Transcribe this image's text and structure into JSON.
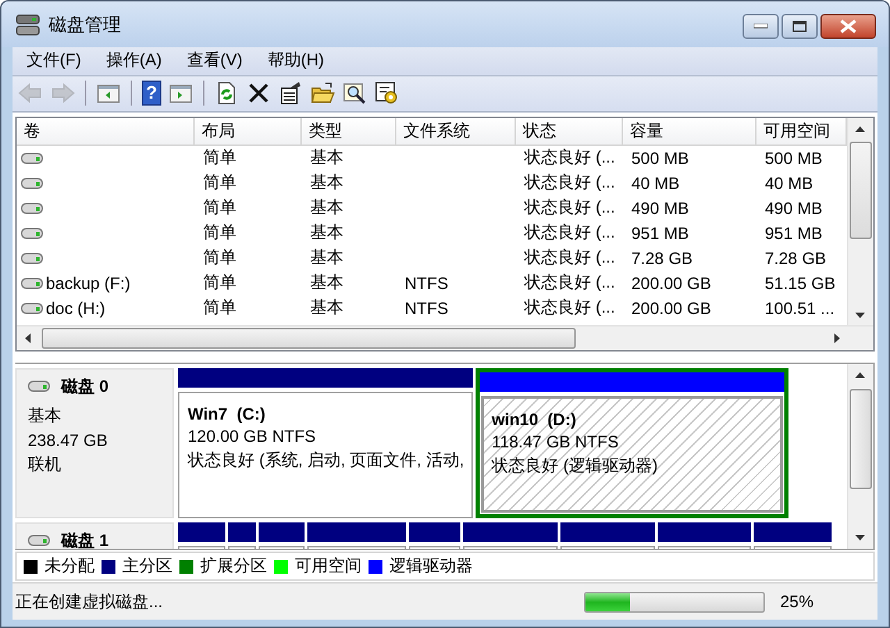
{
  "window": {
    "title": "磁盘管理"
  },
  "menu": [
    "文件(F)",
    "操作(A)",
    "查看(V)",
    "帮助(H)"
  ],
  "toolbar": [
    {
      "kind": "back",
      "disabled": true
    },
    {
      "kind": "forward",
      "disabled": true
    },
    {
      "kind": "separator"
    },
    {
      "kind": "console-tree",
      "disabled": false
    },
    {
      "kind": "separator"
    },
    {
      "kind": "help",
      "disabled": false,
      "glyph": "?"
    },
    {
      "kind": "action-pane",
      "disabled": false
    },
    {
      "kind": "separator"
    },
    {
      "kind": "refresh",
      "disabled": false
    },
    {
      "kind": "delete",
      "disabled": false
    },
    {
      "kind": "properties",
      "disabled": false
    },
    {
      "kind": "open",
      "disabled": false
    },
    {
      "kind": "search",
      "disabled": false
    },
    {
      "kind": "settings",
      "disabled": false
    }
  ],
  "volume_table": {
    "columns": [
      "卷",
      "布局",
      "类型",
      "文件系统",
      "状态",
      "容量",
      "可用空间"
    ],
    "rows": [
      {
        "layout": "简单",
        "type": "基本",
        "status": "状态良好 (...",
        "capacity": "500 MB",
        "free_space": "500 MB"
      },
      {
        "layout": "简单",
        "type": "基本",
        "status": "状态良好 (...",
        "capacity": "40 MB",
        "free_space": "40 MB"
      },
      {
        "layout": "简单",
        "type": "基本",
        "status": "状态良好 (...",
        "capacity": "490 MB",
        "free_space": "490 MB"
      },
      {
        "layout": "简单",
        "type": "基本",
        "status": "状态良好 (...",
        "capacity": "951 MB",
        "free_space": "951 MB"
      },
      {
        "layout": "简单",
        "type": "基本",
        "status": "状态良好 (...",
        "capacity": "7.28 GB",
        "free_space": "7.28 GB"
      },
      {
        "volume": "backup (F:)",
        "layout": "简单",
        "type": "基本",
        "file_system": "NTFS",
        "status": "状态良好 (...",
        "capacity": "200.00 GB",
        "free_space": "51.15 GB"
      },
      {
        "volume": "doc (H:)",
        "layout": "简单",
        "type": "基本",
        "file_system": "NTFS",
        "status": "状态良好 (...",
        "capacity": "200.00 GB",
        "free_space": "100.51 ..."
      }
    ]
  },
  "disks": [
    {
      "name": "磁盘 0",
      "type": "基本",
      "size": "238.47 GB",
      "status": "联机",
      "partitions": [
        {
          "kind": "primary",
          "selected": false,
          "label": "Win7  (C:)",
          "size": "120.00 GB NTFS",
          "status": "状态良好 (系统, 启动, 页面文件, 活动,"
        },
        {
          "kind": "logical",
          "selected": true,
          "label": "win10  (D:)",
          "size": "118.47 GB NTFS",
          "status": "状态良好 (逻辑驱动器)"
        }
      ]
    },
    {
      "name": "磁盘 1",
      "partitions": [
        {
          "kind": "primary"
        },
        {
          "kind": "primary"
        },
        {
          "kind": "primary"
        },
        {
          "kind": "primary"
        },
        {
          "kind": "primary"
        },
        {
          "kind": "primary"
        },
        {
          "kind": "primary"
        },
        {
          "kind": "primary"
        },
        {
          "kind": "primary"
        }
      ]
    }
  ],
  "legend": [
    {
      "label": "未分配",
      "color": "#000000"
    },
    {
      "label": "主分区",
      "color": "#000080"
    },
    {
      "label": "扩展分区",
      "color": "#008000"
    },
    {
      "label": "可用空间",
      "color": "#00ff00"
    },
    {
      "label": "逻辑驱动器",
      "color": "#0000ff"
    }
  ],
  "status_bar": {
    "message": "正在创建虚拟磁盘...",
    "progress": {
      "level": 0.25,
      "reading": "25%"
    }
  }
}
